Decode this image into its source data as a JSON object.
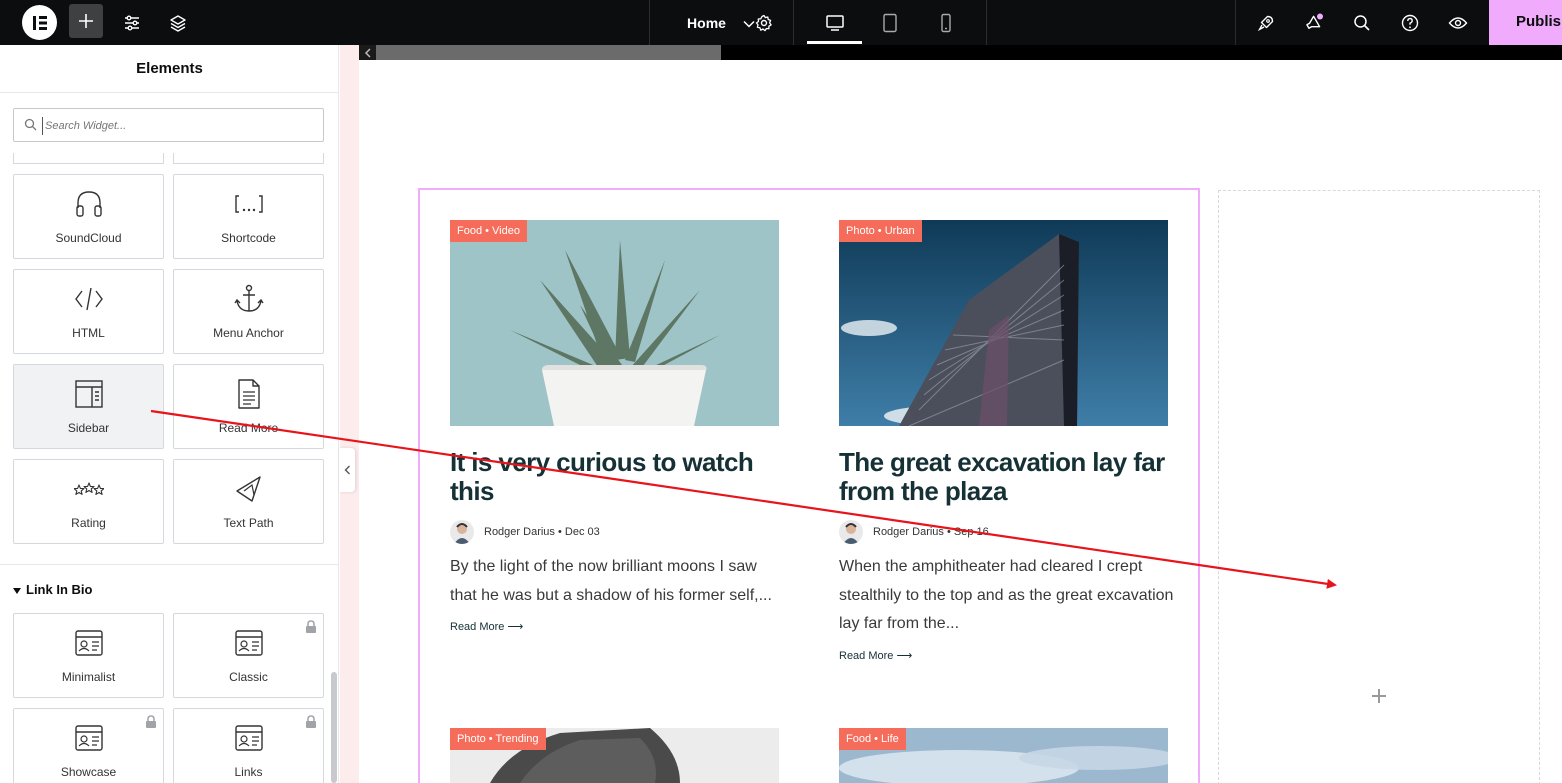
{
  "topbar": {
    "page_name": "Home",
    "publish_label": "Publish",
    "icons": [
      "elementor-logo-icon",
      "plus-icon",
      "sliders-icon",
      "layers-icon",
      "chevron-down-icon",
      "gear-icon",
      "desktop-icon",
      "tablet-icon",
      "mobile-icon",
      "rocket-icon",
      "megaphone-icon",
      "search-icon",
      "help-icon",
      "eye-icon"
    ]
  },
  "panel": {
    "title": "Elements",
    "search_placeholder": "Search Widget...",
    "widgets": [
      {
        "label": "SoundCloud",
        "icon": "headphones-icon"
      },
      {
        "label": "Shortcode",
        "icon": "shortcode-icon"
      },
      {
        "label": "HTML",
        "icon": "code-icon"
      },
      {
        "label": "Menu Anchor",
        "icon": "anchor-icon"
      },
      {
        "label": "Sidebar",
        "icon": "sidebar-icon"
      },
      {
        "label": "Read More",
        "icon": "document-icon"
      },
      {
        "label": "Rating",
        "icon": "stars-icon"
      },
      {
        "label": "Text Path",
        "icon": "text-path-icon"
      }
    ],
    "category": "Link In Bio",
    "bio_widgets": [
      {
        "label": "Minimalist",
        "locked": false
      },
      {
        "label": "Classic",
        "locked": true
      },
      {
        "label": "Showcase",
        "locked": true
      },
      {
        "label": "Links",
        "locked": true
      }
    ]
  },
  "posts": [
    {
      "badge": "Food • Video",
      "title": "It is very curious to watch this",
      "meta": "Rodger Darius • Dec 03",
      "excerpt": "By the light of the now brilliant moons I saw that he was but a shadow of his former self,...",
      "more": "Read More ⟶"
    },
    {
      "badge": "Photo • Urban",
      "title": "The great excavation lay far from the plaza",
      "meta": "Rodger Darius • Sep 16",
      "excerpt": "When the amphitheater had cleared I crept stealthily to the top and as the great excavation lay far from the...",
      "more": "Read More ⟶"
    },
    {
      "badge": "Photo • Trending"
    },
    {
      "badge": "Food • Life"
    }
  ],
  "colors": {
    "accent": "#f0abfc",
    "badge": "#f66c5a",
    "heading": "#163136",
    "drag_arrow": "#e8141b"
  }
}
